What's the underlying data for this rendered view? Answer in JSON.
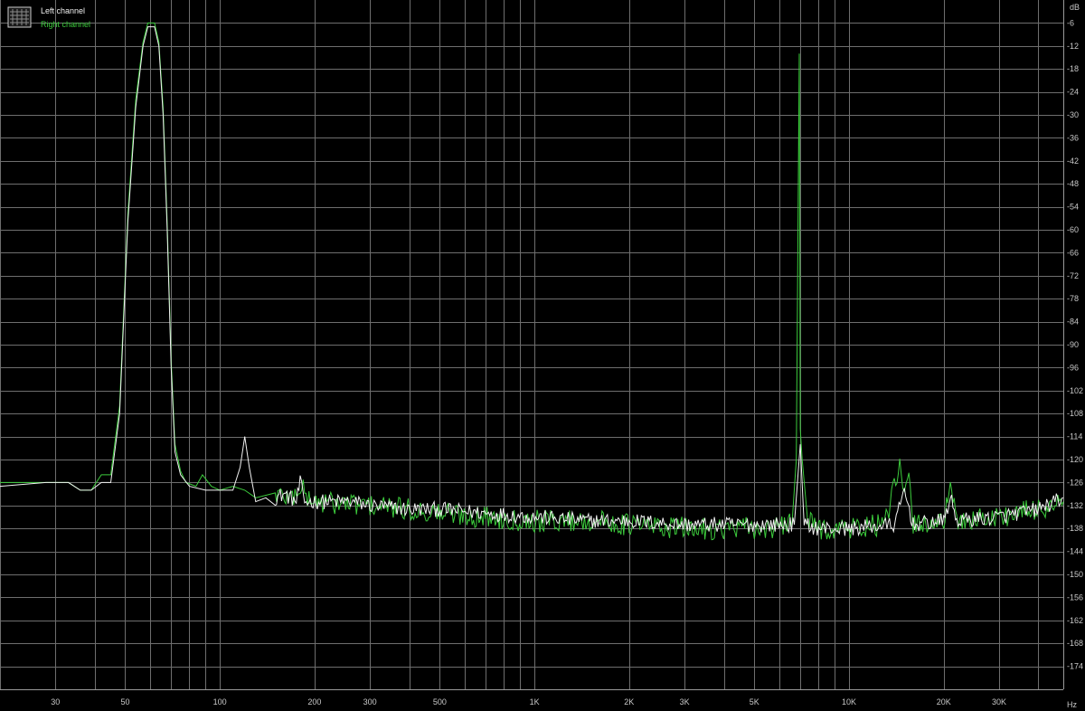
{
  "chart_data": {
    "type": "line",
    "x_scale": "log",
    "xlim": [
      20,
      48000
    ],
    "ylim": [
      -180,
      0
    ],
    "grid": true,
    "x_unit": "Hz",
    "y_unit": "dB",
    "legend_position": "top-left",
    "x_tick_labels": [
      {
        "value": 30,
        "label": "30"
      },
      {
        "value": 50,
        "label": "50"
      },
      {
        "value": 100,
        "label": "100"
      },
      {
        "value": 200,
        "label": "200"
      },
      {
        "value": 300,
        "label": "300"
      },
      {
        "value": 500,
        "label": "500"
      },
      {
        "value": 1000,
        "label": "1K"
      },
      {
        "value": 2000,
        "label": "2K"
      },
      {
        "value": 3000,
        "label": "3K"
      },
      {
        "value": 5000,
        "label": "5K"
      },
      {
        "value": 10000,
        "label": "10K"
      },
      {
        "value": 20000,
        "label": "20K"
      },
      {
        "value": 30000,
        "label": "30K"
      }
    ],
    "y_ticks": [
      -6,
      -12,
      -18,
      -24,
      -30,
      -36,
      -42,
      -48,
      -54,
      -60,
      -66,
      -72,
      -78,
      -84,
      -90,
      -96,
      -102,
      -108,
      -114,
      -120,
      -126,
      -132,
      -138,
      -144,
      -150,
      -156,
      -162,
      -168,
      -174
    ],
    "series": [
      {
        "name": "Left channel",
        "color": "#f2f2f2",
        "points": [
          [
            20,
            -127
          ],
          [
            28,
            -126
          ],
          [
            33,
            -126
          ],
          [
            36,
            -128
          ],
          [
            39,
            -128
          ],
          [
            42,
            -126
          ],
          [
            45,
            -126
          ],
          [
            48,
            -108
          ],
          [
            51,
            -58
          ],
          [
            54,
            -28
          ],
          [
            57,
            -12
          ],
          [
            59,
            -7
          ],
          [
            62,
            -7
          ],
          [
            64,
            -12
          ],
          [
            66,
            -30
          ],
          [
            68,
            -60
          ],
          [
            70,
            -96
          ],
          [
            72,
            -118
          ],
          [
            75,
            -124
          ],
          [
            80,
            -127
          ],
          [
            90,
            -128
          ],
          [
            100,
            -128
          ],
          [
            110,
            -128
          ],
          [
            116,
            -122
          ],
          [
            120,
            -114
          ],
          [
            124,
            -122
          ],
          [
            130,
            -131
          ],
          [
            140,
            -130
          ],
          [
            150,
            -130
          ],
          [
            160,
            -129
          ],
          [
            175,
            -131
          ],
          [
            180,
            -126
          ],
          [
            186,
            -131
          ],
          [
            200,
            -131
          ],
          [
            230,
            -131
          ],
          [
            260,
            -131
          ],
          [
            300,
            -132
          ],
          [
            400,
            -133
          ],
          [
            500,
            -133
          ],
          [
            700,
            -134
          ],
          [
            1000,
            -135
          ],
          [
            1500,
            -136
          ],
          [
            2000,
            -136
          ],
          [
            3000,
            -137
          ],
          [
            4000,
            -137
          ],
          [
            5000,
            -137
          ],
          [
            6000,
            -137
          ],
          [
            6700,
            -137
          ],
          [
            7000,
            -116
          ],
          [
            7200,
            -137
          ],
          [
            8000,
            -138
          ],
          [
            10000,
            -138
          ],
          [
            14000,
            -137
          ],
          [
            15000,
            -128
          ],
          [
            16000,
            -137
          ],
          [
            20000,
            -136
          ],
          [
            21000,
            -130
          ],
          [
            22000,
            -136
          ],
          [
            30000,
            -135
          ],
          [
            40000,
            -133
          ],
          [
            48000,
            -130
          ]
        ]
      },
      {
        "name": "Right channel",
        "color": "#3ccc3c",
        "points": [
          [
            20,
            -126
          ],
          [
            28,
            -126
          ],
          [
            33,
            -126
          ],
          [
            36,
            -128
          ],
          [
            39,
            -128
          ],
          [
            42,
            -124
          ],
          [
            45,
            -124
          ],
          [
            48,
            -106
          ],
          [
            51,
            -56
          ],
          [
            54,
            -26
          ],
          [
            57,
            -11
          ],
          [
            59,
            -6
          ],
          [
            62,
            -6
          ],
          [
            64,
            -11
          ],
          [
            66,
            -28
          ],
          [
            68,
            -58
          ],
          [
            70,
            -94
          ],
          [
            72,
            -116
          ],
          [
            75,
            -123
          ],
          [
            78,
            -126
          ],
          [
            84,
            -127
          ],
          [
            88,
            -124
          ],
          [
            94,
            -127
          ],
          [
            100,
            -128
          ],
          [
            110,
            -127
          ],
          [
            120,
            -128
          ],
          [
            130,
            -130
          ],
          [
            150,
            -129
          ],
          [
            170,
            -130
          ],
          [
            180,
            -127
          ],
          [
            190,
            -130
          ],
          [
            200,
            -131
          ],
          [
            300,
            -132
          ],
          [
            500,
            -134
          ],
          [
            700,
            -135
          ],
          [
            1000,
            -136
          ],
          [
            1500,
            -136
          ],
          [
            2000,
            -137
          ],
          [
            3000,
            -138
          ],
          [
            4000,
            -138
          ],
          [
            5000,
            -138
          ],
          [
            6000,
            -138
          ],
          [
            6600,
            -136
          ],
          [
            6800,
            -120
          ],
          [
            6950,
            -14
          ],
          [
            7000,
            -112
          ],
          [
            7100,
            -120
          ],
          [
            7400,
            -136
          ],
          [
            8000,
            -138
          ],
          [
            10000,
            -138
          ],
          [
            13000,
            -137
          ],
          [
            14500,
            -122
          ],
          [
            15000,
            -130
          ],
          [
            15500,
            -125
          ],
          [
            16000,
            -137
          ],
          [
            20000,
            -136
          ],
          [
            21000,
            -128
          ],
          [
            22000,
            -136
          ],
          [
            30000,
            -135
          ],
          [
            40000,
            -133
          ],
          [
            48000,
            -131
          ]
        ]
      }
    ]
  }
}
